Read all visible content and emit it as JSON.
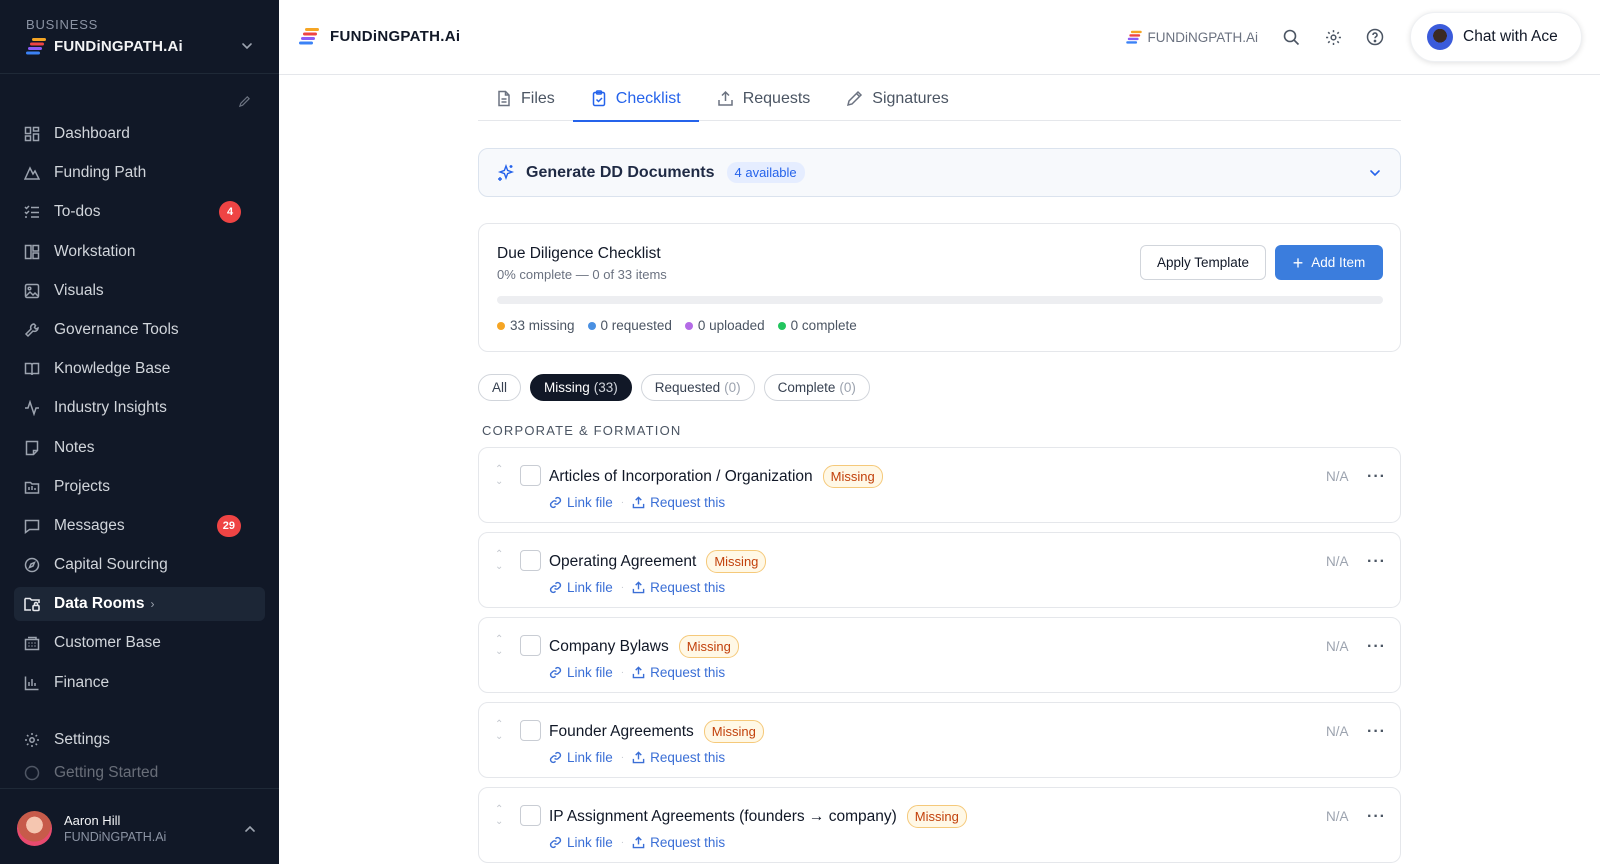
{
  "sidebar": {
    "org_kicker": "BUSINESS",
    "org_name": "FUNDiNGPATH.Ai",
    "items": [
      {
        "label": "Dashboard",
        "icon": "grid-icon"
      },
      {
        "label": "Funding Path",
        "icon": "path-icon"
      },
      {
        "label": "To-dos",
        "icon": "checklist-icon",
        "badge": "4"
      },
      {
        "label": "Workstation",
        "icon": "layout-icon"
      },
      {
        "label": "Visuals",
        "icon": "image-icon"
      },
      {
        "label": "Governance Tools",
        "icon": "wrench-icon"
      },
      {
        "label": "Knowledge Base",
        "icon": "book-icon"
      },
      {
        "label": "Industry Insights",
        "icon": "activity-icon"
      },
      {
        "label": "Notes",
        "icon": "note-icon"
      },
      {
        "label": "Projects",
        "icon": "folder-icon"
      },
      {
        "label": "Messages",
        "icon": "message-icon",
        "badge": "29"
      },
      {
        "label": "Capital Sourcing",
        "icon": "compass-icon"
      },
      {
        "label": "Data Rooms",
        "icon": "folder-lock-icon",
        "active": true
      },
      {
        "label": "Customer Base",
        "icon": "building-icon"
      },
      {
        "label": "Finance",
        "icon": "bar-chart-icon"
      }
    ],
    "settings_label": "Settings",
    "getting_started_label": "Getting Started",
    "user": {
      "name": "Aaron Hill",
      "org": "FUNDiNGPATH.Ai"
    }
  },
  "topbar": {
    "brand": "FUNDiNGPATH.Ai",
    "mini_brand": "FUNDiNGPATH.Ai",
    "chat_label": "Chat with Ace"
  },
  "tabs": [
    {
      "label": "Files",
      "icon": "file-icon"
    },
    {
      "label": "Checklist",
      "icon": "clipboard-icon",
      "active": true
    },
    {
      "label": "Requests",
      "icon": "upload-icon"
    },
    {
      "label": "Signatures",
      "icon": "pen-icon"
    }
  ],
  "generate": {
    "title": "Generate DD Documents",
    "badge": "4 available"
  },
  "checklist": {
    "title": "Due Diligence Checklist",
    "subtitle": "0% complete — 0 of 33 items",
    "progress": 0,
    "apply_template": "Apply Template",
    "add_item": "Add Item",
    "legend": [
      {
        "label": "33 missing",
        "color": "#f5a524"
      },
      {
        "label": "0 requested",
        "color": "#4a90e2"
      },
      {
        "label": "0 uploaded",
        "color": "#b46be6"
      },
      {
        "label": "0 complete",
        "color": "#22c55e"
      }
    ]
  },
  "filters": [
    {
      "label": "All",
      "count": ""
    },
    {
      "label": "Missing",
      "count": "(33)",
      "active": true
    },
    {
      "label": "Requested",
      "count": "(0)"
    },
    {
      "label": "Complete",
      "count": "(0)"
    }
  ],
  "section_label": "CORPORATE & FORMATION",
  "item_actions": {
    "link": "Link file",
    "request": "Request this",
    "separator": "·",
    "na": "N/A"
  },
  "items": [
    {
      "title": "Articles of Incorporation / Organization",
      "status": "Missing"
    },
    {
      "title": "Operating Agreement",
      "status": "Missing"
    },
    {
      "title": "Company Bylaws",
      "status": "Missing"
    },
    {
      "title": "Founder Agreements",
      "status": "Missing"
    },
    {
      "title": "IP Assignment Agreements (founders → company)",
      "status": "Missing"
    }
  ]
}
